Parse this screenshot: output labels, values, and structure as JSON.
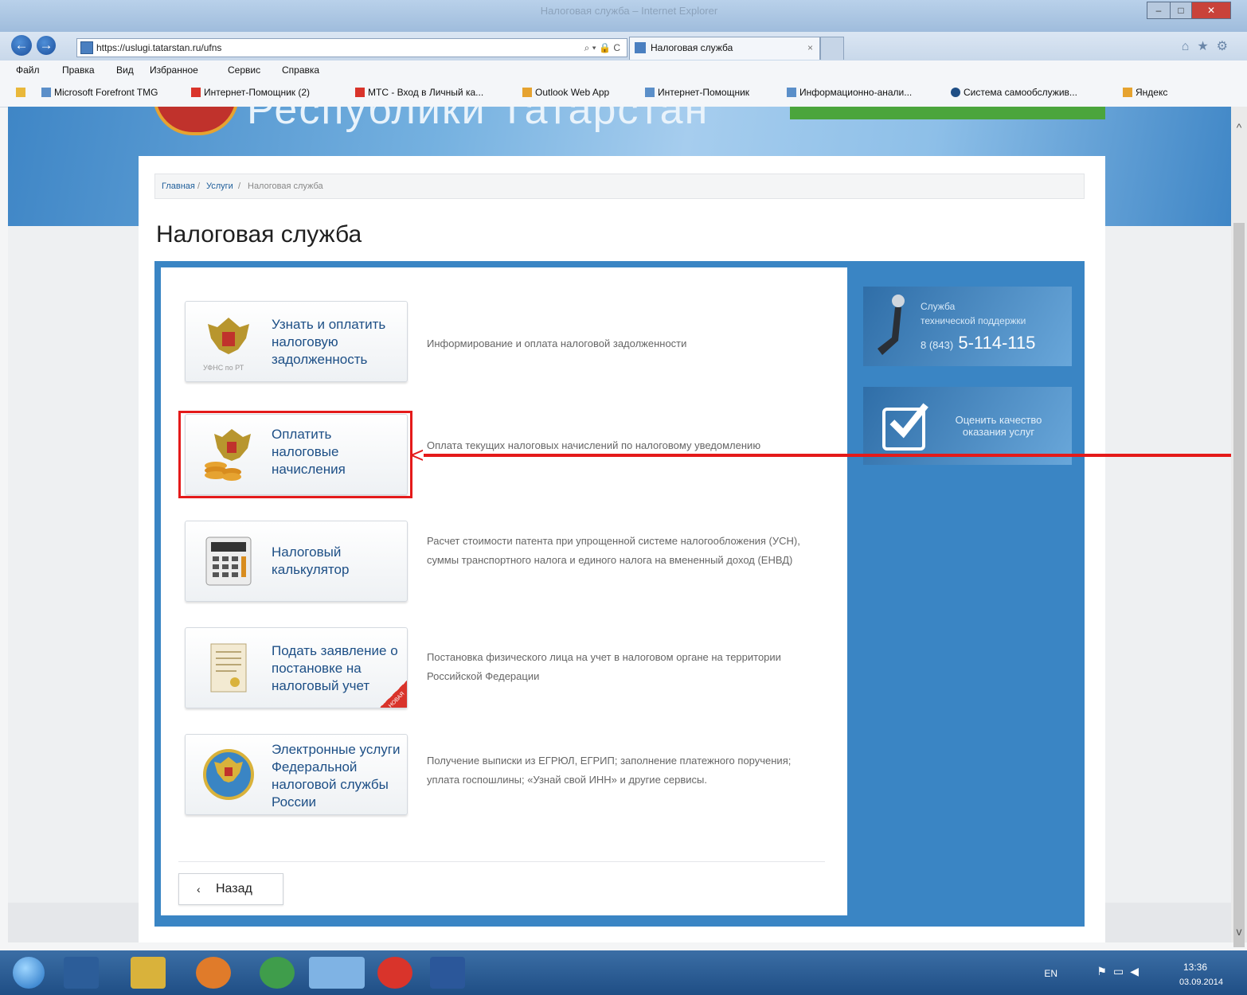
{
  "window": {
    "title": "Налоговая служба – Internet Explorer"
  },
  "browser": {
    "address_url": "https://uslugi.tatarstan.ru/ufns",
    "address_icons": "⌕ ▾ 🔒 C",
    "tab_label": "Налоговая служба",
    "tab_close": "×"
  },
  "menu": [
    "Файл",
    "Правка",
    "Вид",
    "Избранное",
    "Сервис",
    "Справка"
  ],
  "favorites": [
    "Microsoft Forefront TMG",
    "Интернет-Помощник (2)",
    "МТС - Вход в Личный ка...",
    "Outlook Web App",
    "Интернет-Помощник",
    "Информационно-анали...",
    "Система самообслужив...",
    "Яндекс"
  ],
  "header": {
    "title": "Республики Татарстан"
  },
  "breadcrumb": {
    "home": "Главная",
    "sep1": " / ",
    "services": "Услуги",
    "sep2": " / ",
    "current": "Налоговая служба"
  },
  "page": {
    "title": "Налоговая служба"
  },
  "services": [
    {
      "label": "Узнать и оплатить налоговую задолженность",
      "icon_caption": "УФНС по РТ",
      "description": "Информирование и оплата налоговой задолженности"
    },
    {
      "label": "Оплатить налоговые начисления",
      "description": "Оплата текущих налоговых начислений по налоговому уведомлению"
    },
    {
      "label": "Налоговый калькулятор",
      "description": "Расчет стоимости патента при упрощенной системе налогообложения (УСН), суммы транспортного налога и единого налога на вмененный доход (ЕНВД)"
    },
    {
      "label": "Подать заявление о постановке на налоговый учет",
      "badge": "НОВАЯ",
      "description": "Постановка физического лица на учет в налоговом органе на территории Российской Федерации"
    },
    {
      "label": "Электронные услуги Федеральной налоговой службы России",
      "description": "Получение выписки из ЕГРЮЛ, ЕГРИП; заполнение платежного поручения; уплата госпошлины; «Узнай свой ИНН» и другие сервисы."
    }
  ],
  "back_button": "Назад",
  "sidebar": {
    "support_line1": "Служба",
    "support_line2": "технической поддержки",
    "support_prefix": "8 (843)",
    "support_number": "5-114-115",
    "quality": "Оценить качество оказания услуг"
  },
  "taskbar": {
    "lang": "EN",
    "time": "13:36",
    "date": "03.09.2014"
  },
  "colors": {
    "accent": "#3a85c4",
    "highlight": "#e41a1a",
    "link": "#1d4f86"
  }
}
